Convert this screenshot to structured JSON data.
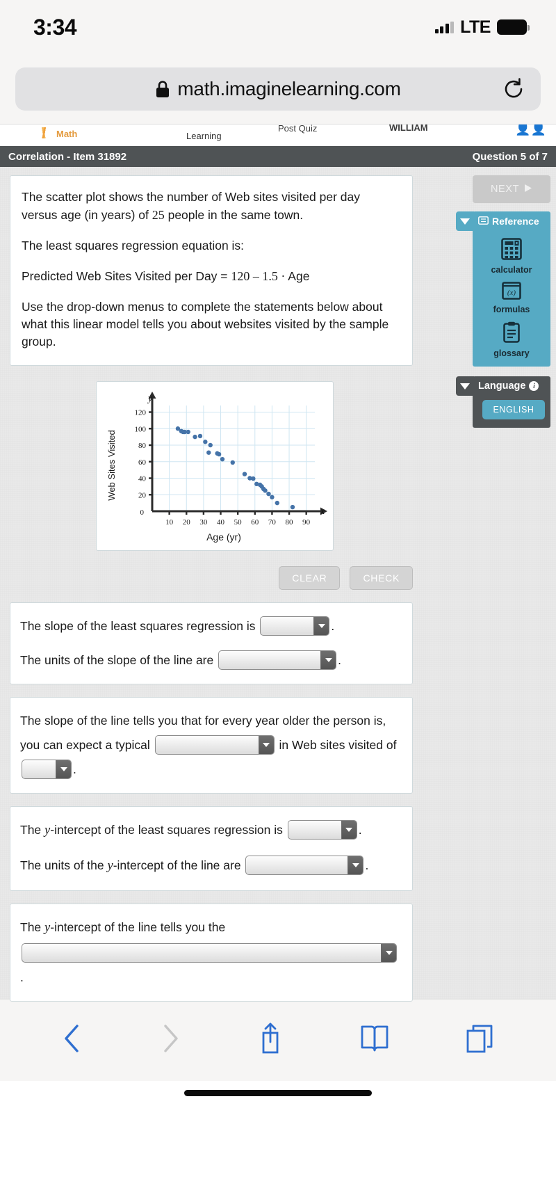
{
  "status_bar": {
    "time": "3:34",
    "network": "LTE",
    "signal_icon": "signal-bars-icon",
    "battery_icon": "battery-full-icon"
  },
  "browser": {
    "url": "math.imaginelearning.com",
    "lock_icon": "lock-icon",
    "reload_icon": "reload-icon",
    "toolbar": {
      "back_icon": "chevron-left-icon",
      "forward_icon": "chevron-right-icon",
      "share_icon": "share-up-arrow-icon",
      "bookmarks_icon": "book-icon",
      "tabs_icon": "tabs-icon"
    }
  },
  "app_nav": {
    "brand": "Math",
    "crumb_learning": "Learning",
    "crumb_quiz": "Post Quiz",
    "crumb_user": "WILLIAM",
    "avatars_icon": "avatars-icon"
  },
  "item_header": {
    "title": "Correlation - Item 31892",
    "progress": "Question 5 of 7"
  },
  "stem": {
    "line1_a": "The scatter plot shows the number of Web sites visited per day versus age (in years) of ",
    "line1_num": "25",
    "line1_b": " people in the same town.",
    "line2": "The least squares regression equation is:",
    "line3_a": "Predicted Web Sites Visited per Day = ",
    "line3_eq": "120 – 1.5 ·",
    "line3_b": " Age",
    "line4": "Use the drop-down menus to complete the statements below about what this linear model tells you about websites visited by the sample group."
  },
  "rail": {
    "next_label": "NEXT",
    "next_icon": "play-triangle-icon",
    "reference_label": "Reference",
    "reference_icon": "reference-book-icon",
    "collapse_icon": "caret-down-icon",
    "tools": [
      {
        "label": "calculator",
        "icon": "calculator-icon"
      },
      {
        "label": "formulas",
        "icon": "formulas-icon"
      },
      {
        "label": "glossary",
        "icon": "glossary-clipboard-icon"
      }
    ],
    "language_label": "Language",
    "language_info_icon": "info-icon",
    "language_value": "ENGLISH"
  },
  "chart_data": {
    "type": "scatter",
    "title": "",
    "xlabel": "Age (yr)",
    "ylabel": "Web Sites Visited",
    "x_axis_symbol": "x",
    "y_axis_symbol": "y",
    "xlim": [
      0,
      95
    ],
    "ylim": [
      0,
      128
    ],
    "xticks": [
      0,
      10,
      20,
      30,
      40,
      50,
      60,
      70,
      80,
      90
    ],
    "yticks": [
      0,
      20,
      40,
      60,
      80,
      100,
      120
    ],
    "grid": true,
    "origin_label": "0",
    "point_color": "#4573a8",
    "grid_color": "#cfe6f2",
    "n_points": 25,
    "points": [
      [
        15,
        100
      ],
      [
        17,
        97
      ],
      [
        18,
        96
      ],
      [
        19,
        96
      ],
      [
        21,
        96
      ],
      [
        25,
        90
      ],
      [
        28,
        91
      ],
      [
        31,
        84
      ],
      [
        34,
        80
      ],
      [
        33,
        71
      ],
      [
        38,
        70
      ],
      [
        39,
        69
      ],
      [
        41,
        63
      ],
      [
        47,
        59
      ],
      [
        54,
        45
      ],
      [
        57,
        40
      ],
      [
        59,
        39.5
      ],
      [
        61,
        33
      ],
      [
        63,
        32
      ],
      [
        64,
        30
      ],
      [
        65,
        27
      ],
      [
        66,
        25
      ],
      [
        68,
        21
      ],
      [
        70,
        17
      ],
      [
        73,
        10
      ],
      [
        82,
        5
      ]
    ]
  },
  "actions": {
    "clear_label": "CLEAR",
    "check_label": "CHECK"
  },
  "answers": [
    {
      "lines": [
        {
          "pre": "The slope of the least squares regression is ",
          "dropdown": "slope-value-dropdown",
          "width": "w-md",
          "post": "."
        }
      ]
    },
    {
      "lines": [
        {
          "pre": "The units of the slope of the line are ",
          "dropdown": "slope-units-dropdown",
          "width": "w-xl2",
          "post": "."
        }
      ]
    },
    {
      "lines": [
        {
          "pre": "The slope of the line tells you that for every year older the person is, you can expect a typical ",
          "dropdown": "change-direction-dropdown",
          "width": "w-lg",
          "mid": " in Web sites visited of ",
          "dropdown2": "change-amount-dropdown",
          "width2": "w-sm",
          "post": "."
        }
      ]
    },
    {
      "lines": [
        {
          "pre": "The ",
          "ital": "y",
          "pre2": "-intercept of the least squares regression is ",
          "dropdown": "yintercept-value-dropdown",
          "width": "w-md",
          "post": "."
        }
      ]
    },
    {
      "lines": [
        {
          "pre": "The units of the ",
          "ital": "y",
          "pre2": "-intercept of the line are ",
          "dropdown": "yintercept-units-dropdown",
          "width": "w-xl2",
          "post": "."
        }
      ]
    },
    {
      "lines": [
        {
          "pre": "The ",
          "ital": "y",
          "pre2": "-intercept of the line tells you the",
          "dropdown": "yintercept-meaning-dropdown",
          "width": "w-xl",
          "post": "."
        }
      ]
    }
  ],
  "answer_text": {
    "a1_l1": "The slope of the least squares regression is",
    "a1_l2": "The units of the slope of the line are",
    "a2_l1a": "The slope of the line tells you that for every year older the person is, you can expect a typical",
    "a2_l1b": "in Web sites visited of",
    "a3_l1a": "The ",
    "a3_l1b": "-intercept of the least squares regression is",
    "a3_l2a": "The units of the ",
    "a3_l2b": "-intercept of the line are",
    "a4_l1a": "The ",
    "a4_l1b": "-intercept of the line tells you the",
    "period": ".",
    "yvar": "y"
  },
  "colors": {
    "header_bar": "#4f5355",
    "reference_panel": "#56aac4",
    "accent_blue": "#2f6fd0",
    "point_blue": "#4573a8"
  }
}
